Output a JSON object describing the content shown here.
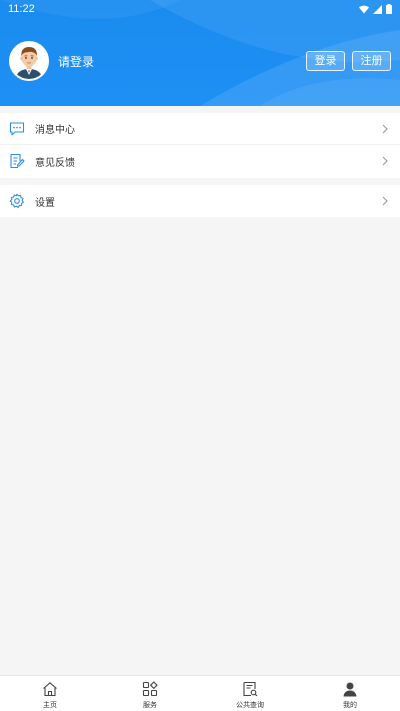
{
  "status_bar": {
    "time": "11:22",
    "icons": [
      "wifi-icon",
      "signal-icon",
      "battery-icon"
    ]
  },
  "header": {
    "login_prompt": "请登录",
    "login_button": "登录",
    "register_button": "注册",
    "background_color": "#1a8cf0"
  },
  "menu": {
    "group1": [
      {
        "icon": "message-icon",
        "label": "消息中心"
      },
      {
        "icon": "feedback-icon",
        "label": "意见反馈"
      }
    ],
    "group2": [
      {
        "icon": "gear-icon",
        "label": "设置"
      }
    ]
  },
  "tabbar": {
    "tabs": [
      {
        "icon": "home-icon",
        "label": "主页"
      },
      {
        "icon": "grid-icon",
        "label": "服务"
      },
      {
        "icon": "search-document-icon",
        "label": "公共查询"
      },
      {
        "icon": "person-icon",
        "label": "我的"
      }
    ]
  },
  "colors": {
    "accent": "#1a8cf0",
    "icon_blue": "#2b8ee6",
    "page_bg": "#f5f5f5"
  }
}
